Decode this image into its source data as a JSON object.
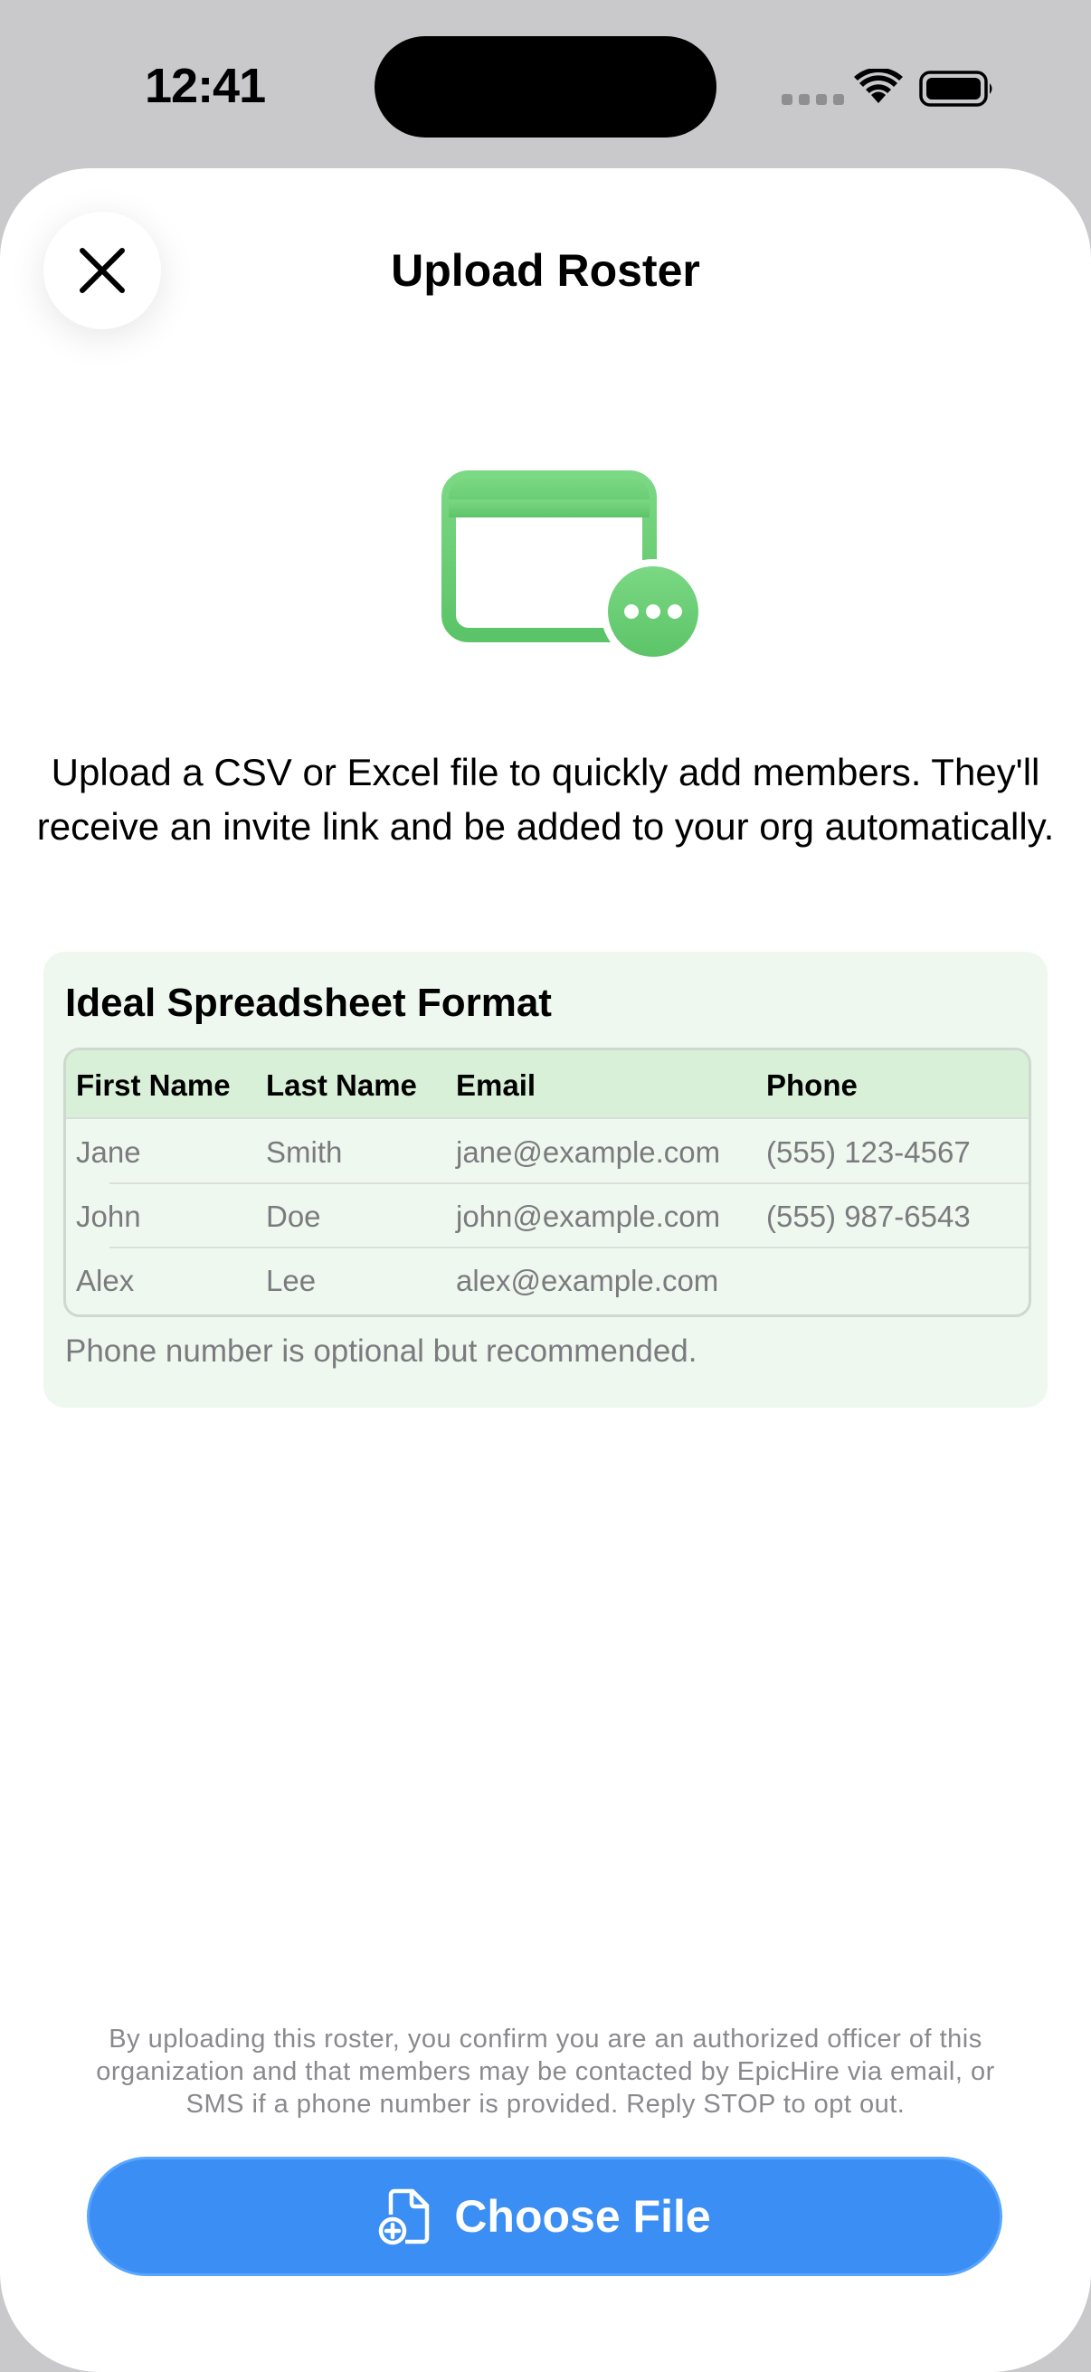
{
  "status_bar": {
    "time": "12:41"
  },
  "sheet": {
    "title": "Upload Roster",
    "close_icon": "close-icon",
    "hero_icon": "spreadsheet-more-icon",
    "description": "Upload a CSV or Excel file to quickly add members. They'll receive an invite link and be added to your org automatically."
  },
  "format_card": {
    "title": "Ideal Spreadsheet Format",
    "columns": [
      "First Name",
      "Last Name",
      "Email",
      "Phone"
    ],
    "rows": [
      [
        "Jane",
        "Smith",
        "jane@example.com",
        "(555) 123-4567"
      ],
      [
        "John",
        "Doe",
        "john@example.com",
        "(555) 987-6543"
      ],
      [
        "Alex",
        "Lee",
        "alex@example.com",
        ""
      ]
    ],
    "note": "Phone number is optional but recommended."
  },
  "legal_text": "By uploading this roster, you confirm you are an authorized officer of this organization and that members may be contacted by EpicHire via email, or SMS if a phone number is provided. Reply STOP to opt out.",
  "choose_button": {
    "label": "Choose File",
    "icon": "document-add-icon"
  },
  "colors": {
    "accent": "#3b8ef3",
    "card_background": "#eff8ef",
    "header_background": "#d8efd8",
    "icon_green": "#6fd07a"
  }
}
